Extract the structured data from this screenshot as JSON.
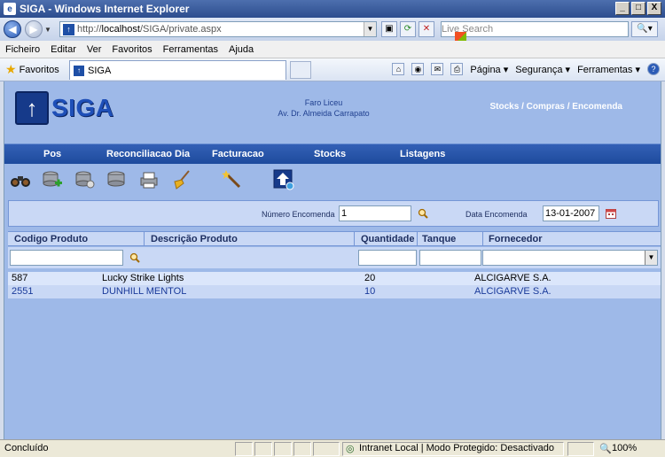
{
  "window": {
    "title": "SIGA - Windows Internet Explorer",
    "buttons": [
      "_",
      "□",
      "X"
    ]
  },
  "addressbar": {
    "url_prefix": "http://",
    "url_host": "localhost",
    "url_path": "/SIGA/private.aspx",
    "search_placeholder": "Live Search"
  },
  "menu": [
    "Ficheiro",
    "Editar",
    "Ver",
    "Favoritos",
    "Ferramentas",
    "Ajuda"
  ],
  "favbar": {
    "favorites_label": "Favoritos",
    "tab_title": "SIGA",
    "commands": [
      "Página ▾",
      "Segurança ▾",
      "Ferramentas ▾"
    ]
  },
  "header": {
    "app_name": "SIGA",
    "org_line1": "Faro Liceu",
    "org_line2": "Av. Dr. Almeida Carrapato",
    "breadcrumb": "Stocks / Compras / Encomenda"
  },
  "nav": [
    "Pos",
    "Reconciliacao Dia",
    "Facturacao",
    "Stocks",
    "Listagens"
  ],
  "toolbar_icons": [
    "binoculars-icon",
    "database-add-icon",
    "database-settings-icon",
    "database-delete-icon",
    "printer-icon",
    "broom-icon",
    "magic-wand-icon",
    "upload-icon"
  ],
  "filter": {
    "order_number_label": "Número Encomenda",
    "order_number_value": "1",
    "order_date_label": "Data Encomenda",
    "order_date_value": "13-01-2007"
  },
  "grid": {
    "columns": [
      "Codigo Produto",
      "Descrição Produto",
      "Quantidade",
      "Tanque",
      "Fornecedor"
    ],
    "rows": [
      {
        "code": "587",
        "desc": "Lucky Strike Lights",
        "qty": "20",
        "tank": "",
        "supplier": "ALCIGARVE S.A."
      },
      {
        "code": "2551",
        "desc": "DUNHILL MENTOL",
        "qty": "10",
        "tank": "",
        "supplier": "ALCIGARVE S.A."
      }
    ]
  },
  "status": {
    "text": "Concluído",
    "zone": "Intranet Local | Modo Protegido: Desactivado",
    "zoom": "100%"
  }
}
